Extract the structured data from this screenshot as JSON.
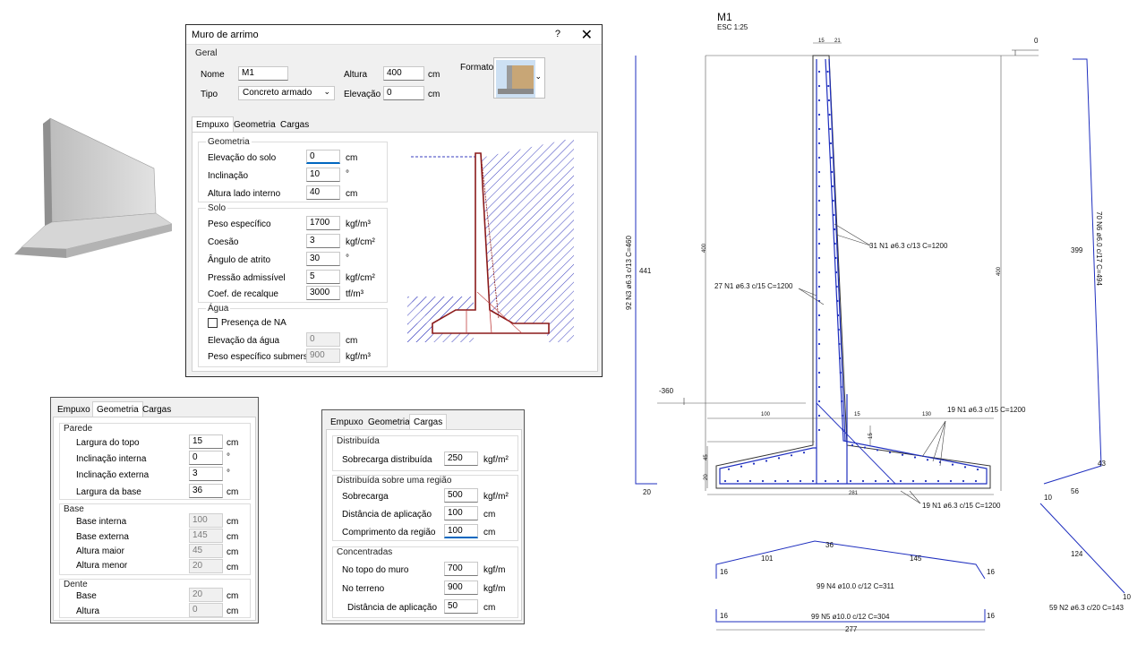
{
  "dialog1": {
    "title": "Muro de arrimo",
    "help": "?",
    "close": "✕",
    "geral": {
      "group_label": "Geral",
      "nome_label": "Nome",
      "nome_value": "M1",
      "tipo_label": "Tipo",
      "tipo_value": "Concreto armado",
      "altura_label": "Altura",
      "altura_value": "400",
      "altura_unit": "cm",
      "elevacao_label": "Elevação",
      "elevacao_value": "0",
      "elevacao_unit": "cm",
      "formato_label": "Formato"
    },
    "tabs": [
      "Empuxo",
      "Geometria",
      "Cargas"
    ],
    "geometria": {
      "group_label": "Geometria",
      "rows": [
        {
          "label": "Elevação do solo",
          "value": "0",
          "unit": "cm"
        },
        {
          "label": "Inclinação",
          "value": "10",
          "unit": "°"
        },
        {
          "label": "Altura lado interno",
          "value": "40",
          "unit": "cm"
        }
      ]
    },
    "solo": {
      "group_label": "Solo",
      "rows": [
        {
          "label": "Peso específico",
          "value": "1700",
          "unit": "kgf/m³"
        },
        {
          "label": "Coesão",
          "value": "3",
          "unit": "kgf/cm²"
        },
        {
          "label": "Ângulo de atrito",
          "value": "30",
          "unit": "°"
        },
        {
          "label": "Pressão admissível",
          "value": "5",
          "unit": "kgf/cm²"
        },
        {
          "label": "Coef. de recalque",
          "value": "3000",
          "unit": "tf/m³"
        }
      ]
    },
    "agua": {
      "group_label": "Água",
      "checkbox_label": "Presença de NA",
      "rows": [
        {
          "label": "Elevação da água",
          "value": "0",
          "unit": "cm"
        },
        {
          "label": "Peso específico submerso",
          "value": "900",
          "unit": "kgf/m³"
        }
      ]
    }
  },
  "dialog2": {
    "tabs": [
      "Empuxo",
      "Geometria",
      "Cargas"
    ],
    "parede": {
      "group_label": "Parede",
      "rows": [
        {
          "label": "Largura do topo",
          "value": "15",
          "unit": "cm"
        },
        {
          "label": "Inclinação interna",
          "value": "0",
          "unit": "°"
        },
        {
          "label": "Inclinação externa",
          "value": "3",
          "unit": "°"
        },
        {
          "label": "Largura da base",
          "value": "36",
          "unit": "cm"
        }
      ]
    },
    "base": {
      "group_label": "Base",
      "rows": [
        {
          "label": "Base interna",
          "value": "100",
          "unit": "cm"
        },
        {
          "label": "Base externa",
          "value": "145",
          "unit": "cm"
        },
        {
          "label": "Altura maior",
          "value": "45",
          "unit": "cm"
        },
        {
          "label": "Altura menor",
          "value": "20",
          "unit": "cm"
        }
      ]
    },
    "dente": {
      "group_label": "Dente",
      "rows": [
        {
          "label": "Base",
          "value": "20",
          "unit": "cm"
        },
        {
          "label": "Altura",
          "value": "0",
          "unit": "cm"
        }
      ]
    }
  },
  "dialog3": {
    "tabs": [
      "Empuxo",
      "Geometria",
      "Cargas"
    ],
    "distribuida": {
      "group_label": "Distribuída",
      "rows": [
        {
          "label": "Sobrecarga distribuída",
          "value": "250",
          "unit": "kgf/m²"
        }
      ]
    },
    "regiao": {
      "group_label": "Distribuída sobre uma região",
      "rows": [
        {
          "label": "Sobrecarga",
          "value": "500",
          "unit": "kgf/m²"
        },
        {
          "label": "Distância de aplicação",
          "value": "100",
          "unit": "cm"
        },
        {
          "label": "Comprimento da região",
          "value": "100",
          "unit": "cm"
        }
      ]
    },
    "concentradas": {
      "group_label": "Concentradas",
      "rows": [
        {
          "label": "No topo do muro",
          "value": "700",
          "unit": "kgf/m"
        },
        {
          "label": "No terreno",
          "value": "900",
          "unit": "kgf/m"
        },
        {
          "label": "Distância de aplicação",
          "value": "50",
          "unit": "cm"
        }
      ]
    }
  },
  "drawing": {
    "title": "M1",
    "scale": "ESC 1:25",
    "dims": {
      "top15": "15",
      "top21": "21",
      "level0": "0",
      "level_neg360": "-360",
      "d100": "100",
      "d15": "15",
      "d130": "130",
      "d281": "281",
      "d441": "441",
      "d20": "20",
      "d399": "399",
      "d43": "43",
      "d56": "56",
      "d10a": "10",
      "d124": "124",
      "d10b": "10",
      "d101": "101",
      "d36": "36",
      "d145": "145",
      "d16a": "16",
      "d16b": "16",
      "d16c": "16",
      "d16d": "16",
      "d277": "277",
      "wall400a": "400",
      "wall400b": "400",
      "d45": "45",
      "d20v": "20",
      "d15v": "15"
    },
    "rebar_labels": {
      "n1_31": "31 N1 ø6.3 c/13 C=1200",
      "n1_27": "27 N1 ø6.3 c/15 C=1200",
      "n1_19a": "19 N1 ø6.3 c/15 C=1200",
      "n1_19b": "19 N1 ø6.3 c/15 C=1200",
      "n3": "92 N3 ø6.3 c/13 C=460",
      "n6": "70 N6 ø6.0 c/17 C=494",
      "n4": "99 N4 ø10.0 c/12 C=311",
      "n5": "99 N5 ø10.0 c/12 C=304",
      "n2": "59 N2 ø6.3 c/20 C=143"
    },
    "colors": {
      "rebar": "#1f2fbf",
      "concrete": "#333333",
      "hatch": "#3a3fbf",
      "section": "#8b1a1a"
    }
  }
}
